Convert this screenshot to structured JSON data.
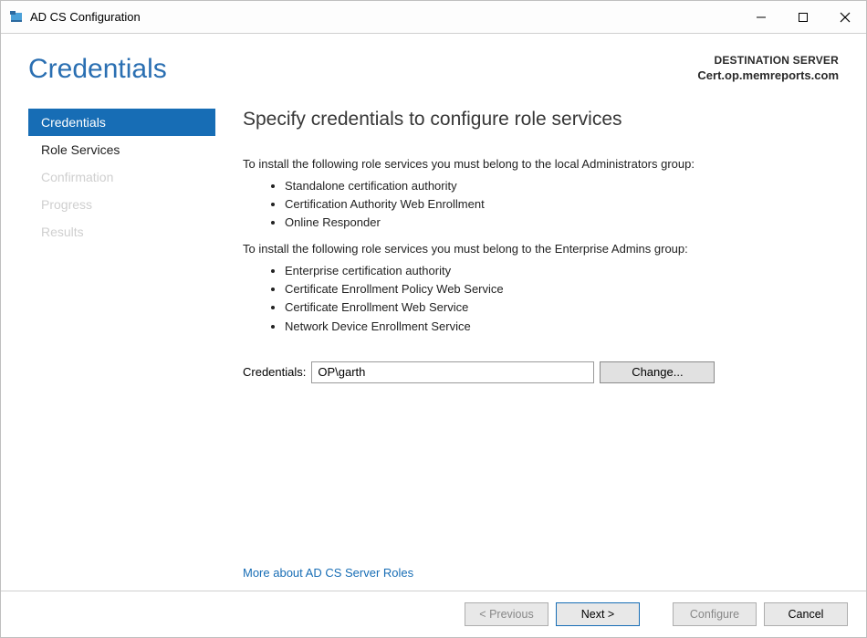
{
  "window": {
    "title": "AD CS Configuration"
  },
  "header": {
    "page_title": "Credentials",
    "dest_label": "DESTINATION SERVER",
    "dest_server": "Cert.op.memreports.com"
  },
  "sidebar": {
    "items": [
      {
        "label": "Credentials",
        "enabled": true,
        "selected": true
      },
      {
        "label": "Role Services",
        "enabled": true,
        "selected": false
      },
      {
        "label": "Confirmation",
        "enabled": false,
        "selected": false
      },
      {
        "label": "Progress",
        "enabled": false,
        "selected": false
      },
      {
        "label": "Results",
        "enabled": false,
        "selected": false
      }
    ]
  },
  "content": {
    "heading": "Specify credentials to configure role services",
    "local_admins_intro": "To install the following role services you must belong to the local Administrators group:",
    "local_admins_items": [
      "Standalone certification authority",
      "Certification Authority Web Enrollment",
      "Online Responder"
    ],
    "enterprise_admins_intro": "To install the following role services you must belong to the Enterprise Admins group:",
    "enterprise_admins_items": [
      "Enterprise certification authority",
      "Certificate Enrollment Policy Web Service",
      "Certificate Enrollment Web Service",
      "Network Device Enrollment Service"
    ],
    "credentials_label": "Credentials:",
    "credentials_value": "OP\\garth",
    "change_button": "Change...",
    "more_link": "More about AD CS Server Roles"
  },
  "footer": {
    "previous": "< Previous",
    "next": "Next >",
    "configure": "Configure",
    "cancel": "Cancel"
  }
}
